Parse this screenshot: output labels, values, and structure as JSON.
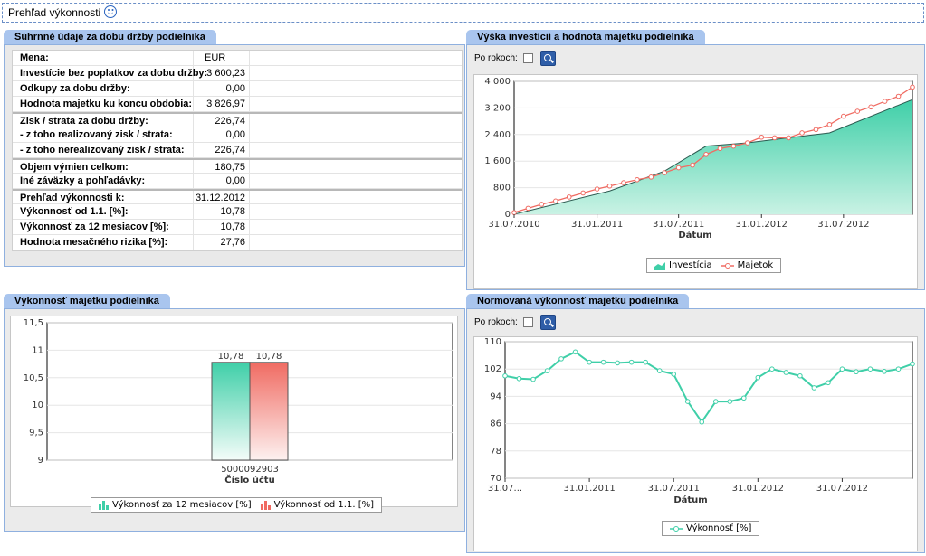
{
  "page_title": "Prehľad výkonnosti",
  "summary": {
    "title": "Súhrnné údaje za dobu držby podielnika",
    "rows": [
      {
        "label": "Mena:",
        "value": "EUR",
        "align": "left",
        "sep": false
      },
      {
        "label": "Investície bez poplatkov za dobu držby:",
        "value": "3 600,23",
        "sep": false
      },
      {
        "label": "Odkupy za dobu držby:",
        "value": "0,00",
        "sep": false
      },
      {
        "label": "Hodnota majetku ku koncu obdobia:",
        "value": "3 826,97",
        "sep": false
      },
      {
        "label": "Zisk / strata za dobu držby:",
        "value": "226,74",
        "sep": true
      },
      {
        "label": "- z toho realizovaný zisk / strata:",
        "value": "0,00",
        "sep": false
      },
      {
        "label": "- z toho nerealizovaný zisk / strata:",
        "value": "226,74",
        "sep": false
      },
      {
        "label": "Objem výmien celkom:",
        "value": "180,75",
        "sep": true
      },
      {
        "label": "Iné záväzky a pohľadávky:",
        "value": "0,00",
        "sep": false
      },
      {
        "label": "Prehľad výkonnosti k:",
        "value": "31.12.2012",
        "sep": true
      },
      {
        "label": "Výkonnosť od 1.1. [%]:",
        "value": "10,78",
        "sep": false
      },
      {
        "label": "Výkonnosť za 12 mesiacov [%]:",
        "value": "10,78",
        "sep": false
      },
      {
        "label": "Hodnota mesačného rizika [%]:",
        "value": "27,76",
        "sep": false
      }
    ]
  },
  "invest_panel": {
    "title": "Výška investícií a hodnota majetku podielnika",
    "po_rokoch_label": "Po rokoch:",
    "legend": [
      "Investícia",
      "Majetok"
    ]
  },
  "perf_panel": {
    "title": "Výkonnosť majetku podielnika",
    "legend": [
      "Výkonnosť za 12 mesiacov [%]",
      "Výkonnosť od 1.1. [%]"
    ]
  },
  "norm_panel": {
    "title": "Normovaná výkonnosť majetku podielnika",
    "po_rokoch_label": "Po rokoch:",
    "legend": [
      "Výkonnosť [%]"
    ]
  },
  "colors": {
    "teal": "#3fcfa8",
    "red": "#f06b62",
    "accent": "#a9c5ee"
  },
  "chart_data": [
    {
      "type": "area",
      "xlabel": "Dátum",
      "ylabel": "",
      "ylim": [
        0,
        4000
      ],
      "yticks": [
        "0",
        "800",
        "1 600",
        "2 400",
        "3 200",
        "4 000"
      ],
      "xticks": [
        "31.07.2010",
        "31.01.2011",
        "31.07.2011",
        "31.01.2012",
        "31.07.2012"
      ],
      "x_start": "2010-07-31",
      "x_end": "2012-12-31",
      "series": [
        {
          "name": "Investícia",
          "type": "area",
          "dates": [
            "2010-07-31",
            "2011-02-28",
            "2011-06-30",
            "2011-09-30",
            "2011-12-31",
            "2012-06-30",
            "2012-12-31"
          ],
          "values": [
            0,
            700,
            1300,
            2050,
            2150,
            2450,
            3450
          ]
        },
        {
          "name": "Majetok",
          "type": "line",
          "dates": [
            "2010-07-31",
            "2010-08-31",
            "2010-09-30",
            "2010-10-31",
            "2010-11-30",
            "2010-12-31",
            "2011-01-31",
            "2011-02-28",
            "2011-03-31",
            "2011-04-30",
            "2011-05-31",
            "2011-06-30",
            "2011-07-31",
            "2011-08-31",
            "2011-09-30",
            "2011-10-31",
            "2011-11-30",
            "2011-12-31",
            "2012-01-31",
            "2012-02-29",
            "2012-03-31",
            "2012-04-30",
            "2012-05-31",
            "2012-06-30",
            "2012-07-31",
            "2012-08-31",
            "2012-09-30",
            "2012-10-31",
            "2012-11-30",
            "2012-12-31"
          ],
          "values": [
            50,
            180,
            300,
            400,
            520,
            640,
            760,
            850,
            950,
            1040,
            1120,
            1250,
            1400,
            1480,
            1800,
            1980,
            2050,
            2150,
            2320,
            2300,
            2300,
            2450,
            2550,
            2700,
            2950,
            3100,
            3230,
            3400,
            3550,
            3827
          ]
        }
      ]
    },
    {
      "type": "bar",
      "xlabel": "Číslo účtu",
      "ylabel": "",
      "categories": [
        "5000092903"
      ],
      "ylim": [
        9,
        11.5
      ],
      "yticks": [
        "9",
        "9,5",
        "10",
        "10,5",
        "11",
        "11,5"
      ],
      "series": [
        {
          "name": "Výkonnosť za 12 mesiacov [%]",
          "values": [
            10.78
          ],
          "label": "10,78"
        },
        {
          "name": "Výkonnosť od 1.1. [%]",
          "values": [
            10.78
          ],
          "label": "10,78"
        }
      ]
    },
    {
      "type": "line",
      "xlabel": "Dátum",
      "ylabel": "",
      "ylim": [
        70,
        110
      ],
      "yticks": [
        "70",
        "78",
        "86",
        "94",
        "102",
        "110"
      ],
      "xticks": [
        "31.07...",
        "31.01.2011",
        "31.07.2011",
        "31.01.2012",
        "31.07.2012"
      ],
      "series": [
        {
          "name": "Výkonnosť [%]",
          "values": [
            100,
            99.2,
            99,
            101.5,
            105,
            107,
            104,
            104,
            103.8,
            104,
            104,
            101.5,
            100.5,
            92.5,
            86.5,
            92.5,
            92.5,
            93.5,
            99.5,
            102,
            101,
            100,
            96.5,
            98,
            102,
            101.2,
            102,
            101.3,
            102,
            103.5
          ]
        }
      ]
    }
  ]
}
